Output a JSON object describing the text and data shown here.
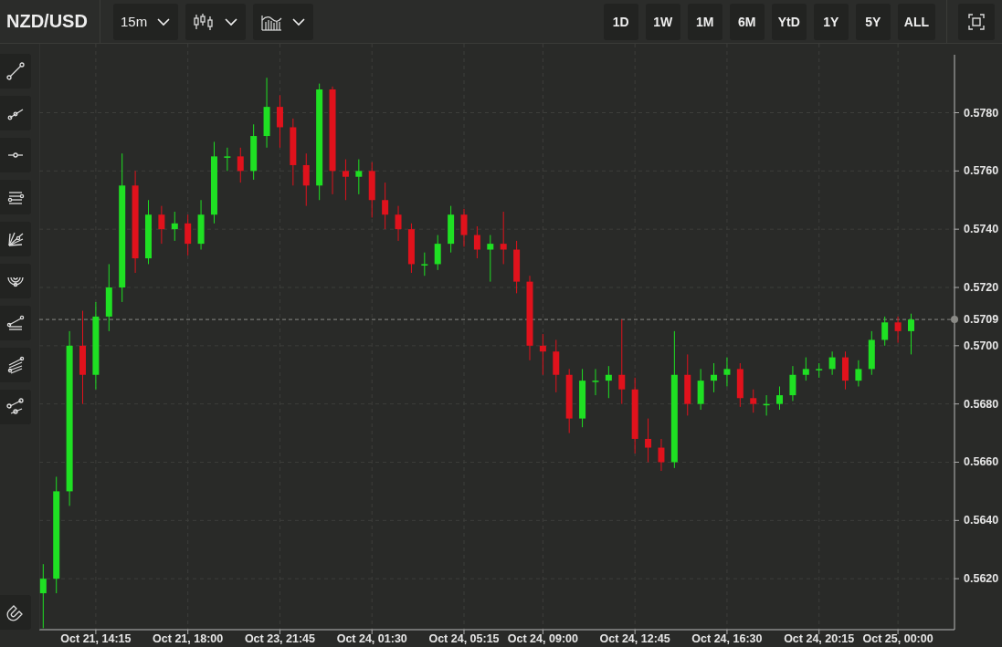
{
  "header": {
    "symbol": "NZD/USD",
    "interval": "15m"
  },
  "ranges": [
    {
      "label": "1D"
    },
    {
      "label": "1W"
    },
    {
      "label": "1M"
    },
    {
      "label": "6M"
    },
    {
      "label": "YtD"
    },
    {
      "label": "1Y"
    },
    {
      "label": "5Y"
    },
    {
      "label": "ALL"
    }
  ],
  "tools": [
    {
      "kind": "line"
    },
    {
      "kind": "ray"
    },
    {
      "kind": "horizontal"
    },
    {
      "kind": "channel"
    },
    {
      "kind": "fan"
    },
    {
      "kind": "arcs"
    },
    {
      "kind": "pitchfork"
    },
    {
      "kind": "parallel"
    },
    {
      "kind": "segments"
    },
    {
      "kind": "magnet"
    }
  ],
  "chart_data": {
    "type": "candlestick",
    "grid": true,
    "categories": [
      null,
      null,
      null,
      null,
      "Oct 21, 14:15",
      null,
      null,
      null,
      null,
      null,
      null,
      "Oct 21, 18:00",
      null,
      null,
      null,
      null,
      null,
      null,
      "Oct 23, 21:45",
      null,
      null,
      null,
      null,
      null,
      null,
      "Oct 24, 01:30",
      null,
      null,
      null,
      null,
      null,
      null,
      "Oct 24, 05:15",
      null,
      null,
      null,
      null,
      null,
      "Oct 24, 09:00",
      null,
      null,
      null,
      null,
      null,
      null,
      "Oct 24, 12:45",
      null,
      null,
      null,
      null,
      null,
      null,
      "Oct 24, 16:30",
      null,
      null,
      null,
      null,
      null,
      null,
      "Oct 24, 20:15",
      null,
      null,
      null,
      null,
      null,
      "Oct 25, 00:00",
      null
    ],
    "ohlc": [
      [
        0.5615,
        0.5625,
        0.5603,
        0.562
      ],
      [
        0.562,
        0.5655,
        0.5615,
        0.565
      ],
      [
        0.565,
        0.5705,
        0.5645,
        0.57
      ],
      [
        0.57,
        0.5712,
        0.568,
        0.569
      ],
      [
        0.569,
        0.5715,
        0.5685,
        0.571
      ],
      [
        0.571,
        0.5728,
        0.5705,
        0.572
      ],
      [
        0.572,
        0.5766,
        0.5715,
        0.5755
      ],
      [
        0.5755,
        0.576,
        0.5725,
        0.573
      ],
      [
        0.573,
        0.575,
        0.5728,
        0.5745
      ],
      [
        0.5745,
        0.5748,
        0.5735,
        0.574
      ],
      [
        0.574,
        0.5746,
        0.5736,
        0.5742
      ],
      [
        0.5742,
        0.5745,
        0.5731,
        0.5735
      ],
      [
        0.5735,
        0.575,
        0.5733,
        0.5745
      ],
      [
        0.5745,
        0.577,
        0.5742,
        0.5765
      ],
      [
        0.5765,
        0.5768,
        0.576,
        0.5765
      ],
      [
        0.5765,
        0.5768,
        0.5756,
        0.576
      ],
      [
        0.576,
        0.5776,
        0.5757,
        0.5772
      ],
      [
        0.5772,
        0.5792,
        0.5768,
        0.5782
      ],
      [
        0.5782,
        0.5786,
        0.5768,
        0.5775
      ],
      [
        0.5775,
        0.5778,
        0.5755,
        0.5762
      ],
      [
        0.5762,
        0.5766,
        0.5748,
        0.5755
      ],
      [
        0.5755,
        0.579,
        0.575,
        0.5788
      ],
      [
        0.5788,
        0.5789,
        0.5752,
        0.576
      ],
      [
        0.576,
        0.5764,
        0.575,
        0.5758
      ],
      [
        0.5758,
        0.5764,
        0.5752,
        0.576
      ],
      [
        0.576,
        0.5763,
        0.5744,
        0.575
      ],
      [
        0.575,
        0.5756,
        0.574,
        0.5745
      ],
      [
        0.5745,
        0.5748,
        0.5736,
        0.574
      ],
      [
        0.574,
        0.5742,
        0.5725,
        0.5728
      ],
      [
        0.5728,
        0.5732,
        0.5724,
        0.5728
      ],
      [
        0.5728,
        0.5738,
        0.5726,
        0.5735
      ],
      [
        0.5735,
        0.5748,
        0.5732,
        0.5745
      ],
      [
        0.5745,
        0.5747,
        0.5734,
        0.5738
      ],
      [
        0.5738,
        0.5741,
        0.573,
        0.5733
      ],
      [
        0.5733,
        0.5738,
        0.5722,
        0.5735
      ],
      [
        0.5735,
        0.5746,
        0.5728,
        0.5733
      ],
      [
        0.5733,
        0.5736,
        0.5718,
        0.5722
      ],
      [
        0.5722,
        0.5724,
        0.5695,
        0.57
      ],
      [
        0.57,
        0.5704,
        0.569,
        0.5698
      ],
      [
        0.5698,
        0.5702,
        0.5684,
        0.569
      ],
      [
        0.569,
        0.5692,
        0.567,
        0.5675
      ],
      [
        0.5675,
        0.5692,
        0.5672,
        0.5688
      ],
      [
        0.5688,
        0.5692,
        0.5683,
        0.5688
      ],
      [
        0.5688,
        0.5693,
        0.5682,
        0.569
      ],
      [
        0.569,
        0.5709,
        0.568,
        0.5685
      ],
      [
        0.5685,
        0.5689,
        0.5663,
        0.5668
      ],
      [
        0.5668,
        0.5675,
        0.566,
        0.5665
      ],
      [
        0.5665,
        0.5668,
        0.5657,
        0.566
      ],
      [
        0.566,
        0.5705,
        0.5658,
        0.569
      ],
      [
        0.569,
        0.5697,
        0.5676,
        0.568
      ],
      [
        0.568,
        0.5692,
        0.5678,
        0.5688
      ],
      [
        0.5688,
        0.5694,
        0.5684,
        0.569
      ],
      [
        0.569,
        0.5696,
        0.5686,
        0.5692
      ],
      [
        0.5692,
        0.5694,
        0.5679,
        0.5682
      ],
      [
        0.5682,
        0.5685,
        0.5677,
        0.568
      ],
      [
        0.568,
        0.5683,
        0.5676,
        0.568
      ],
      [
        0.568,
        0.5686,
        0.5678,
        0.5683
      ],
      [
        0.5683,
        0.5693,
        0.5681,
        0.569
      ],
      [
        0.569,
        0.5696,
        0.5688,
        0.5692
      ],
      [
        0.5692,
        0.5694,
        0.5689,
        0.5692
      ],
      [
        0.5692,
        0.5698,
        0.569,
        0.5696
      ],
      [
        0.5696,
        0.5698,
        0.5685,
        0.5688
      ],
      [
        0.5688,
        0.5695,
        0.5686,
        0.5692
      ],
      [
        0.5692,
        0.5705,
        0.569,
        0.5702
      ],
      [
        0.5702,
        0.571,
        0.57,
        0.5708
      ],
      [
        0.5708,
        0.571,
        0.5701,
        0.5705
      ],
      [
        0.5705,
        0.5711,
        0.5697,
        0.5709
      ]
    ],
    "ylim": [
      0.56025,
      0.57999
    ],
    "yticks": [
      {
        "value": 0.562,
        "label": "0.5620"
      },
      {
        "value": 0.564,
        "label": "0.5640"
      },
      {
        "value": 0.566,
        "label": "0.5660"
      },
      {
        "value": 0.568,
        "label": "0.5680"
      },
      {
        "value": 0.57,
        "label": "0.5700"
      },
      {
        "value": 0.572,
        "label": "0.5720"
      },
      {
        "value": 0.574,
        "label": "0.5740"
      },
      {
        "value": 0.576,
        "label": "0.5760"
      },
      {
        "value": 0.578,
        "label": "0.5780"
      }
    ],
    "ref_lines": [
      {
        "axis": "y",
        "value": 0.5709,
        "label": "0.5709"
      }
    ]
  }
}
